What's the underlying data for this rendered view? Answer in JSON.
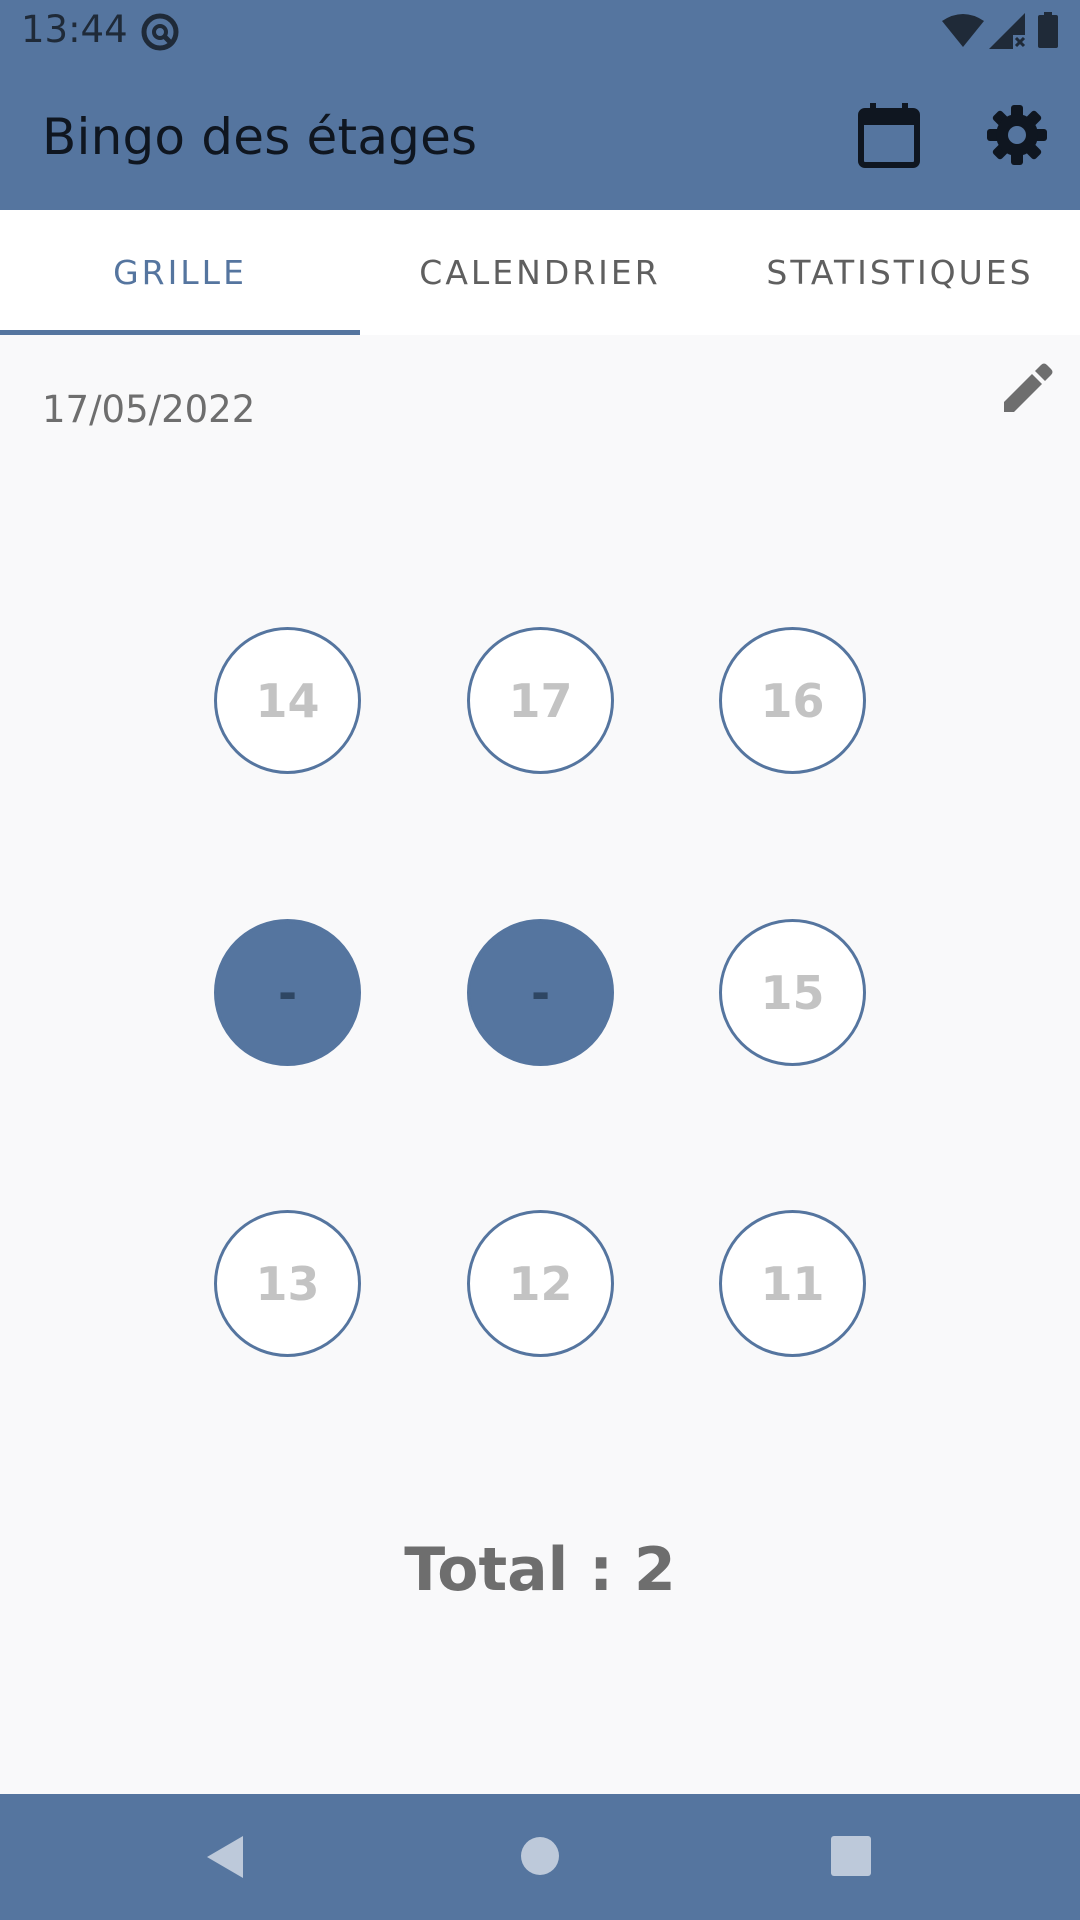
{
  "status_bar": {
    "time": "13:44",
    "icons": [
      "app-notification-icon",
      "wifi-icon",
      "signal-icon",
      "battery-icon"
    ]
  },
  "app_bar": {
    "title": "Bingo des étages",
    "actions": [
      "calendar-icon",
      "settings-icon"
    ]
  },
  "tabs": [
    {
      "label": "GRILLE",
      "active": true
    },
    {
      "label": "CALENDRIER",
      "active": false
    },
    {
      "label": "STATISTIQUES",
      "active": false
    }
  ],
  "grid": {
    "date": "17/05/2022",
    "edit_icon": "pencil-icon",
    "cells": [
      {
        "label": "14",
        "filled": false
      },
      {
        "label": "17",
        "filled": false
      },
      {
        "label": "16",
        "filled": false
      },
      {
        "label": "-",
        "filled": true
      },
      {
        "label": "-",
        "filled": true
      },
      {
        "label": "15",
        "filled": false
      },
      {
        "label": "13",
        "filled": false
      },
      {
        "label": "12",
        "filled": false
      },
      {
        "label": "11",
        "filled": false
      }
    ],
    "total": "Total : 2"
  },
  "nav_bar": {
    "buttons": [
      "back-icon",
      "home-icon",
      "recents-icon"
    ]
  },
  "colors": {
    "primary": "#55759f",
    "background": "#f9f9fa",
    "cell_text": "#c3c3c3",
    "muted_text": "#6e6e6e"
  }
}
